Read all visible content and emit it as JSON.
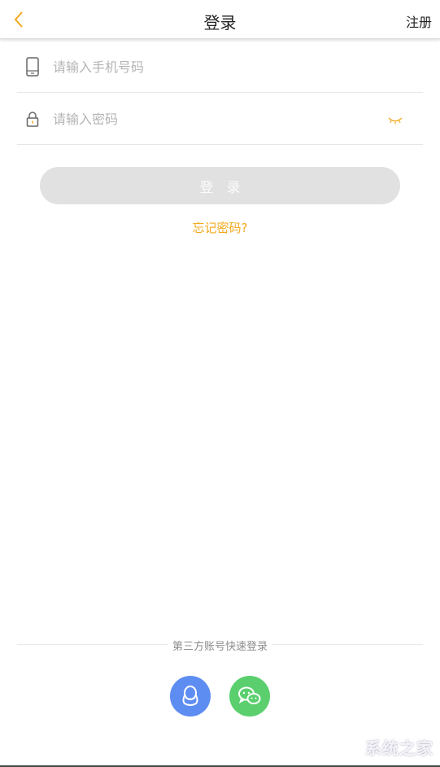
{
  "header": {
    "title": "登录",
    "register_label": "注册"
  },
  "form": {
    "phone_placeholder": "请输入手机号码",
    "password_placeholder": "请输入密码",
    "login_label": "登录",
    "forgot_label": "忘记密码?"
  },
  "third_party": {
    "label": "第三方账号快速登录",
    "providers": [
      "qq-icon",
      "wechat-icon"
    ]
  },
  "watermark": "系统之家",
  "colors": {
    "accent": "#f3a81d",
    "button_disabled": "#e1e1e1",
    "qq": "#5e8df2",
    "wechat": "#5bcf6e"
  }
}
